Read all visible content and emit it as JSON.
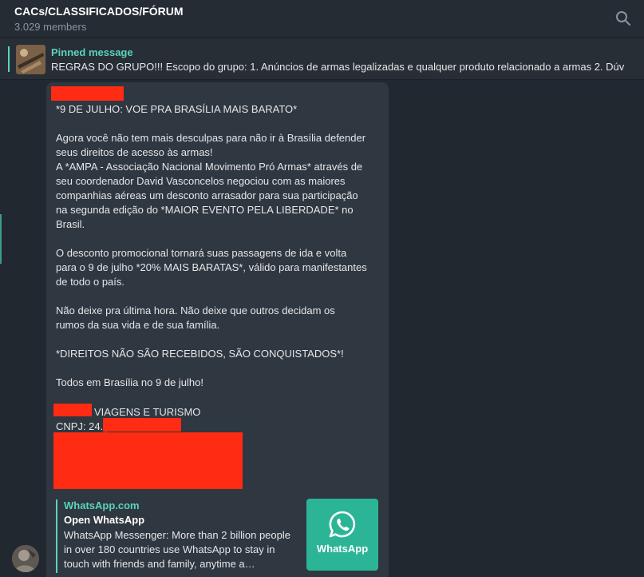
{
  "header": {
    "title": "CACs/CLASSIFICADOS/FÓRUM",
    "members": "3.029 members",
    "search_icon": "search-icon"
  },
  "pinned": {
    "label": "Pinned message",
    "text": "REGRAS DO GRUPO!!!  Escopo do grupo:   1. Anúncios de armas legalizadas e qualquer produto relacionado a armas  2. Dúv",
    "accent_color": "#5ad3bd"
  },
  "message": {
    "line_title": "*9 DE JULHO: VOE PRA BRASÍLIA MAIS BARATO*",
    "para1": "Agora você não tem mais desculpas para não ir à Brasília defender\nseus direitos de acesso às armas!\nA *AMPA - Associação Nacional Movimento Pró Armas* através de\nseu coordenador David Vasconcelos negociou com as maiores\ncompanhias aéreas um desconto arrasador para sua participação\nna segunda edição do *MAIOR EVENTO PELA LIBERDADE* no\nBrasil.",
    "para2": "O desconto promocional tornará suas passagens de ida e volta\npara o 9 de julho *20% MAIS BARATAS*, válido para manifestantes\nde todo o país.",
    "para3": "Não deixe pra última hora. Não deixe que outros decidam os\nrumos da sua vida e de sua família.",
    "para4": "*DIREITOS NÃO SÃO RECEBIDOS, SÃO CONQUISTADOS*!",
    "para5": "Todos em Brasília no 9 de julho!",
    "brand_suffix": "VIAGENS E TURISMO",
    "cnpj": "CNPJ: 24.(",
    "redaction_color": "#ff2b12"
  },
  "link_preview": {
    "site": "WhatsApp.com",
    "title": "Open WhatsApp",
    "description": "WhatsApp Messenger: More than 2 billion people in over 180 countries use WhatsApp to stay in touch with friends and family, anytime a…",
    "thumb_label": "WhatsApp",
    "thumb_icon": "whatsapp-icon",
    "thumb_color": "#2bb596"
  }
}
